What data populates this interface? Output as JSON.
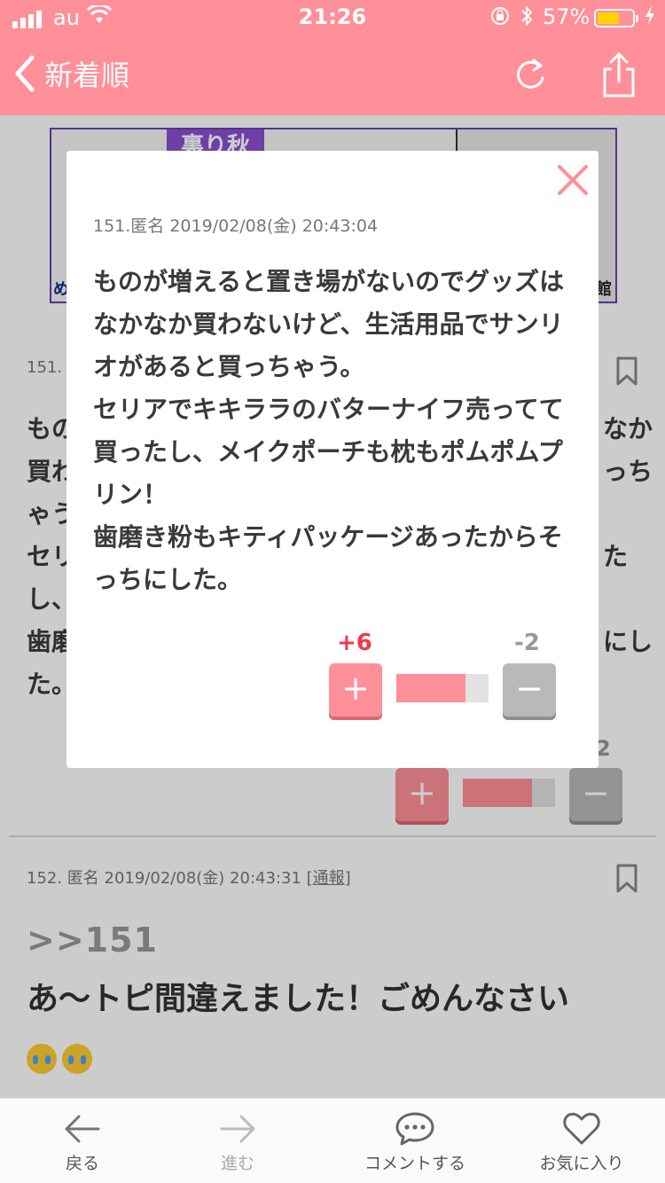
{
  "status_bar": {
    "carrier": "au",
    "time": "21:26",
    "battery": "57%"
  },
  "nav": {
    "back_label": "新着順"
  },
  "ad": {
    "strip_text": "裏り秋",
    "caption_left": "め",
    "caption_right": "館"
  },
  "background_post": {
    "meta": "151.",
    "body_lines": [
      "もの",
      "買わ",
      "ゃう",
      "セリ",
      "し、",
      "歯磨",
      "た。"
    ],
    "right_fragments": [
      "なか",
      "っち",
      "た",
      "にし"
    ],
    "minus_count": "2"
  },
  "next_post": {
    "meta_prefix": "152. 匿名 2019/02/08(金) 20:43:31 [",
    "report_label": "通報",
    "meta_suffix": "]",
    "reply_ref": ">>151",
    "body": "あ〜トピ間違えました！ごめんなさい"
  },
  "modal": {
    "meta": "151.匿名 2019/02/08(金) 20:43:04",
    "body": "ものが増えると置き場がないのでグッズはなかなか買わないけど、生活用品でサンリオがあると買っちゃう。\nセリアでキキララのバターナイフ売ってて買ったし、メイクポーチも枕もポムポムプリン！\n歯磨き粉もキティパッケージあったからそっちにした。",
    "plus_count": "+6",
    "minus_count": "-2",
    "plus_button": "+",
    "minus_button": "−",
    "vote_ratio": 0.75
  },
  "tabbar": {
    "items": [
      {
        "label": "戻る",
        "icon": "arrow-left-icon"
      },
      {
        "label": "進む",
        "icon": "arrow-right-icon"
      },
      {
        "label": "コメントする",
        "icon": "comment-icon"
      },
      {
        "label": "お気に入り",
        "icon": "heart-icon"
      }
    ]
  },
  "colors": {
    "accent": "#ff8f98",
    "plus_text": "#ee3a4a",
    "minus": "#b9b9b9"
  }
}
